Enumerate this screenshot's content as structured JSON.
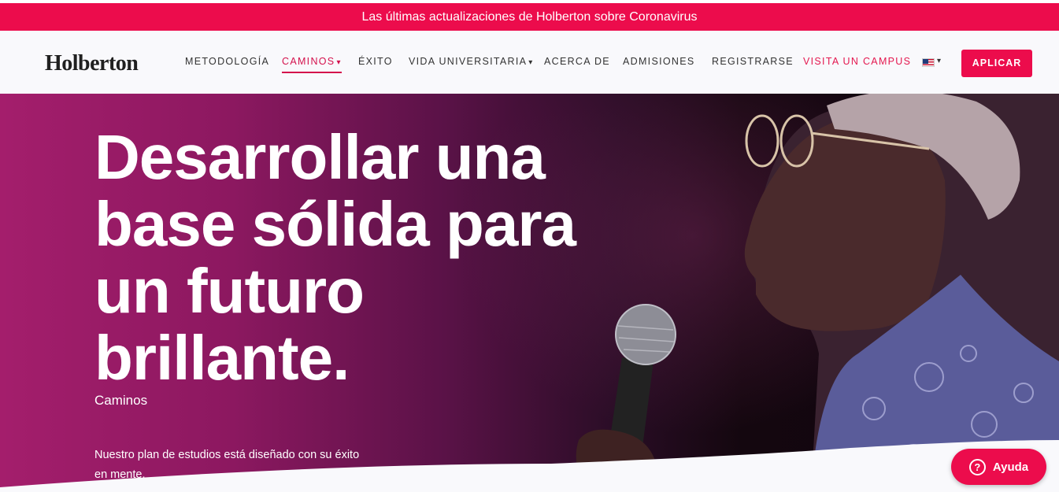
{
  "announcement": "Las últimas actualizaciones de Holberton sobre Coronavirus",
  "header": {
    "logo": "Holberton",
    "nav": {
      "metodologia": "METODOLOGÍA",
      "caminos": "CAMINOS",
      "exito": "ÉXITO",
      "vida": "VIDA UNIVERSITARIA",
      "acerca": "ACERCA DE",
      "admisiones": "ADMISIONES",
      "registrarse": "REGISTRARSE",
      "visita": "VISITA UN CAMPUS"
    },
    "caret": "▾",
    "language_icon": "us-flag-icon",
    "apply_label": "APLICAR"
  },
  "hero": {
    "title": "Desarrollar una base sólida para un futuro brillante.",
    "subtitle": "Caminos",
    "description": "Nuestro plan de estudios está diseñado con su éxito en mente.",
    "image": "speaker-with-microphone-photo"
  },
  "help": {
    "icon": "question-circle-icon",
    "icon_glyph": "?",
    "label": "Ayuda"
  },
  "colors": {
    "brand": "#ec0c4c",
    "nav_active": "#d4114c",
    "nav_text": "#333333"
  }
}
